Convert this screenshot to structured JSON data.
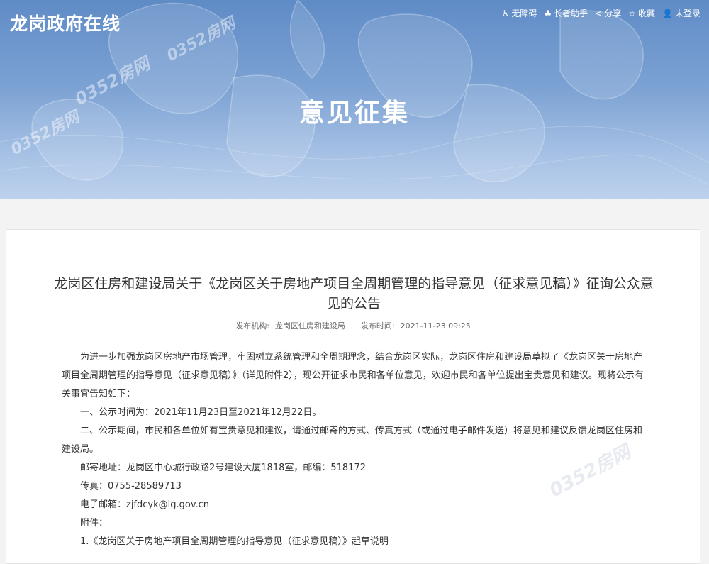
{
  "site": {
    "title": "龙岗政府在线"
  },
  "toolbar": [
    {
      "icon": "♿",
      "label": "无障碍"
    },
    {
      "icon": "♣",
      "label": "长者助手"
    },
    {
      "icon": "<",
      "label": "分享"
    },
    {
      "icon": "☆",
      "label": "收藏"
    },
    {
      "icon": "👤",
      "label": "未登录"
    }
  ],
  "banner": {
    "heading": "意见征集",
    "watermark": "0352房网"
  },
  "article": {
    "title": "龙岗区住房和建设局关于《龙岗区关于房地产项目全周期管理的指导意见（征求意见稿）》征询公众意见的公告",
    "publisher_label": "发布机构:",
    "publisher": "龙岗区住房和建设局",
    "time_label": "发布时间:",
    "time": "2021-11-23 09:25",
    "paragraphs": [
      "为进一步加强龙岗区房地产市场管理，牢固树立系统管理和全周期理念，结合龙岗区实际，龙岗区住房和建设局草拟了《龙岗区关于房地产项目全周期管理的指导意见（征求意见稿）》（详见附件2），现公开征求市民和各单位意见，欢迎市民和各单位提出宝贵意见和建议。现将公示有关事宜告知如下：",
      "一、公示时间为：2021年11月23日至2021年12月22日。",
      "二、公示期间，市民和各单位如有宝贵意见和建议，请通过邮寄的方式、传真方式（或通过电子邮件发送）将意见和建议反馈龙岗区住房和建设局。",
      "邮寄地址：龙岗区中心城行政路2号建设大厦1818室，邮编：518172",
      "传真：0755-28589713",
      "电子邮箱：zjfdcyk@lg.gov.cn",
      "附件：",
      "1.《龙岗区关于房地产项目全周期管理的指导意见（征求意见稿）》起草说明"
    ]
  },
  "colors": {
    "banner_top": "#5f8bc6",
    "banner_bottom": "#bcd1ec",
    "page_bg": "#f3f3f3"
  }
}
